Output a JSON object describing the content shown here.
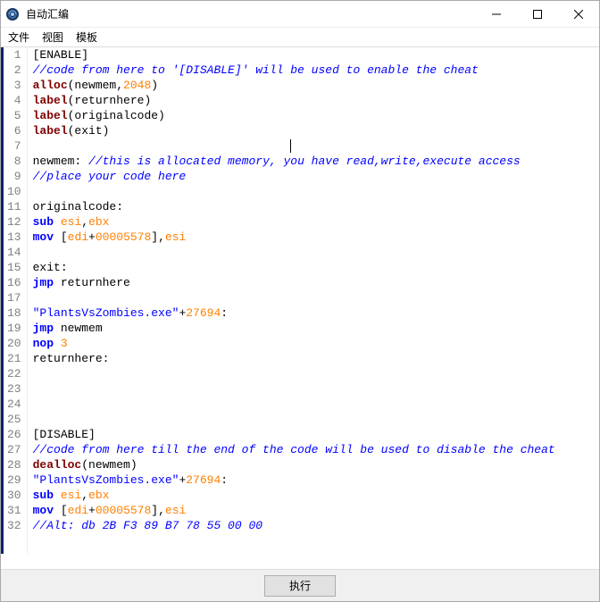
{
  "window": {
    "title": "自动汇编"
  },
  "menu": {
    "file": "文件",
    "view": "视图",
    "template": "模板"
  },
  "caret": {
    "line": 7,
    "col": 40
  },
  "code_lines": [
    [
      {
        "c": "c-plain",
        "t": "[ENABLE]"
      }
    ],
    [
      {
        "c": "c-comment",
        "t": "//code from here to '[DISABLE]' will be used to enable the cheat"
      }
    ],
    [
      {
        "c": "c-func",
        "t": "alloc"
      },
      {
        "c": "c-punct",
        "t": "(newmem,"
      },
      {
        "c": "c-num",
        "t": "2048"
      },
      {
        "c": "c-punct",
        "t": ")"
      }
    ],
    [
      {
        "c": "c-func",
        "t": "label"
      },
      {
        "c": "c-punct",
        "t": "(returnhere)"
      }
    ],
    [
      {
        "c": "c-func",
        "t": "label"
      },
      {
        "c": "c-punct",
        "t": "(originalcode)"
      }
    ],
    [
      {
        "c": "c-func",
        "t": "label"
      },
      {
        "c": "c-punct",
        "t": "(exit)"
      }
    ],
    [],
    [
      {
        "c": "c-plain",
        "t": "newmem: "
      },
      {
        "c": "c-comment",
        "t": "//this is allocated memory, you have read,write,execute access"
      }
    ],
    [
      {
        "c": "c-comment",
        "t": "//place your code here"
      }
    ],
    [],
    [
      {
        "c": "c-plain",
        "t": "originalcode:"
      }
    ],
    [
      {
        "c": "c-keyword",
        "t": "sub "
      },
      {
        "c": "c-reg",
        "t": "esi"
      },
      {
        "c": "c-punct",
        "t": ","
      },
      {
        "c": "c-reg",
        "t": "ebx"
      }
    ],
    [
      {
        "c": "c-keyword",
        "t": "mov "
      },
      {
        "c": "c-punct",
        "t": "["
      },
      {
        "c": "c-reg",
        "t": "edi"
      },
      {
        "c": "c-punct",
        "t": "+"
      },
      {
        "c": "c-num",
        "t": "00005578"
      },
      {
        "c": "c-punct",
        "t": "],"
      },
      {
        "c": "c-reg",
        "t": "esi"
      }
    ],
    [],
    [
      {
        "c": "c-plain",
        "t": "exit:"
      }
    ],
    [
      {
        "c": "c-keyword",
        "t": "jmp "
      },
      {
        "c": "c-plain",
        "t": "returnhere"
      }
    ],
    [],
    [
      {
        "c": "c-str",
        "t": "\"PlantsVsZombies.exe\""
      },
      {
        "c": "c-punct",
        "t": "+"
      },
      {
        "c": "c-num",
        "t": "27694"
      },
      {
        "c": "c-punct",
        "t": ":"
      }
    ],
    [
      {
        "c": "c-keyword",
        "t": "jmp "
      },
      {
        "c": "c-plain",
        "t": "newmem"
      }
    ],
    [
      {
        "c": "c-keyword",
        "t": "nop "
      },
      {
        "c": "c-num",
        "t": "3"
      }
    ],
    [
      {
        "c": "c-plain",
        "t": "returnhere:"
      }
    ],
    [],
    [],
    [],
    [],
    [
      {
        "c": "c-plain",
        "t": "[DISABLE]"
      }
    ],
    [
      {
        "c": "c-comment",
        "t": "//code from here till the end of the code will be used to disable the cheat"
      }
    ],
    [
      {
        "c": "c-func",
        "t": "dealloc"
      },
      {
        "c": "c-punct",
        "t": "(newmem)"
      }
    ],
    [
      {
        "c": "c-str",
        "t": "\"PlantsVsZombies.exe\""
      },
      {
        "c": "c-punct",
        "t": "+"
      },
      {
        "c": "c-num",
        "t": "27694"
      },
      {
        "c": "c-punct",
        "t": ":"
      }
    ],
    [
      {
        "c": "c-keyword",
        "t": "sub "
      },
      {
        "c": "c-reg",
        "t": "esi"
      },
      {
        "c": "c-punct",
        "t": ","
      },
      {
        "c": "c-reg",
        "t": "ebx"
      }
    ],
    [
      {
        "c": "c-keyword",
        "t": "mov "
      },
      {
        "c": "c-punct",
        "t": "["
      },
      {
        "c": "c-reg",
        "t": "edi"
      },
      {
        "c": "c-punct",
        "t": "+"
      },
      {
        "c": "c-num",
        "t": "00005578"
      },
      {
        "c": "c-punct",
        "t": "],"
      },
      {
        "c": "c-reg",
        "t": "esi"
      }
    ],
    [
      {
        "c": "c-comment",
        "t": "//Alt: db 2B F3 89 B7 78 55 00 00"
      }
    ]
  ],
  "buttons": {
    "execute": "执行"
  }
}
